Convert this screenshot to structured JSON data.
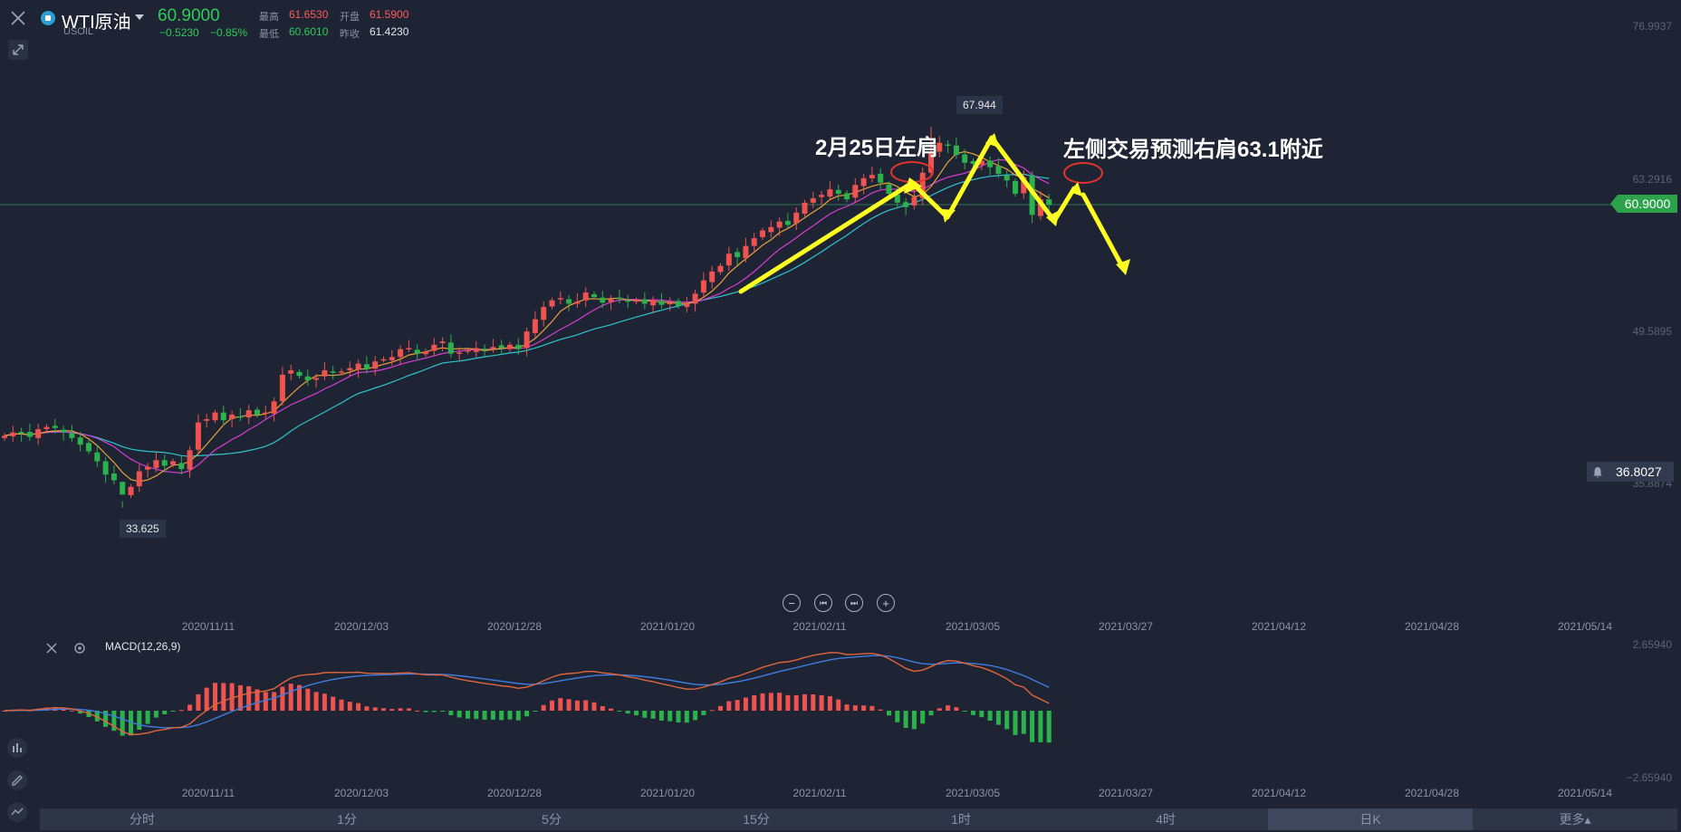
{
  "header": {
    "name": "WTI原油",
    "symbol": "USOIL",
    "price": "60.9000",
    "change": "−0.5230",
    "change_pct": "−0.85%",
    "stats": {
      "high_label": "最高",
      "high_value": "61.6530",
      "open_label": "开盘",
      "open_value": "61.5900",
      "low_label": "最低",
      "low_value": "60.6010",
      "prev_close_label": "昨收",
      "prev_close_value": "61.4230"
    }
  },
  "main_axis": {
    "labels": [
      "76.9937",
      "63.2916",
      "49.5895",
      "35.8874"
    ],
    "current_price_tag": "60.9000",
    "alert_tag": "36.8027"
  },
  "markers": {
    "high": "67.944",
    "low": "33.625"
  },
  "annotations": {
    "left_shoulder": "2月25日左肩",
    "right_shoulder": "左侧交易预测右肩63.1附近"
  },
  "x_axis": {
    "labels": [
      "2020/11/11",
      "2020/12/03",
      "2020/12/28",
      "2021/01/20",
      "2021/02/11",
      "2021/03/05",
      "2021/03/27",
      "2021/04/12",
      "2021/04/28",
      "2021/05/14"
    ]
  },
  "macd": {
    "label": "MACD(12,26,9)",
    "axis_labels": [
      "2.65940",
      "−2.65940"
    ]
  },
  "tabs": [
    "分时",
    "1分",
    "5分",
    "15分",
    "1时",
    "4时",
    "日K",
    "更多▴"
  ],
  "active_tab": "日K",
  "colors": {
    "background": "#1e2433",
    "up": "#ef5350",
    "down": "#2bb24c",
    "ma5": "#e9a23b",
    "ma10": "#d63fd0",
    "ma20": "#2fc4cf",
    "dif": "#e0653c",
    "dea": "#3e7ee0",
    "annotation_arrow": "#ffff22"
  },
  "chart_data": {
    "type": "candlestick",
    "y_axis_ticks": [
      76.9937,
      63.2916,
      49.5895,
      35.8874
    ],
    "x_ticks": [
      "2020/11/11",
      "2020/12/03",
      "2020/12/28",
      "2021/01/20",
      "2021/02/11",
      "2021/03/05",
      "2021/03/27",
      "2021/04/12",
      "2021/04/28",
      "2021/05/14"
    ],
    "high_marker": 67.944,
    "low_marker": 33.625,
    "last_price": 60.9,
    "candles_close": [
      40.1,
      40.4,
      40.3,
      40.0,
      40.7,
      40.9,
      40.8,
      40.4,
      39.9,
      39.3,
      38.7,
      37.8,
      36.6,
      36.1,
      34.8,
      35.5,
      36.9,
      37.3,
      37.9,
      37.4,
      37.8,
      37.1,
      38.8,
      41.3,
      41.6,
      42.2,
      41.5,
      42.0,
      41.8,
      42.4,
      42.0,
      42.2,
      43.2,
      45.6,
      46.0,
      45.5,
      45.1,
      45.3,
      46.0,
      45.8,
      45.9,
      46.2,
      46.6,
      46.1,
      46.8,
      47.0,
      47.2,
      47.9,
      48.0,
      47.5,
      47.7,
      48.3,
      48.6,
      47.5,
      47.6,
      47.8,
      48.0,
      47.9,
      48.1,
      48.0,
      48.3,
      47.9,
      49.5,
      50.6,
      51.7,
      52.3,
      52.5,
      52.0,
      52.2,
      53.0,
      52.6,
      52.1,
      52.4,
      52.4,
      52.2,
      52.3,
      52.0,
      52.3,
      51.9,
      52.1,
      51.8,
      52.0,
      52.9,
      54.1,
      54.9,
      55.4,
      56.5,
      56.2,
      57.2,
      57.9,
      58.6,
      58.9,
      59.4,
      59.1,
      60.2,
      61.1,
      61.5,
      61.8,
      62.3,
      61.9,
      61.4,
      62.7,
      63.3,
      63.6,
      62.9,
      61.9,
      61.1,
      60.7,
      61.6,
      63.8,
      65.6,
      66.5,
      66.3,
      65.4,
      64.7,
      64.6,
      64.9,
      64.3,
      63.7,
      63.1,
      61.9,
      63.4,
      60.0,
      61.4,
      60.9
    ]
  }
}
